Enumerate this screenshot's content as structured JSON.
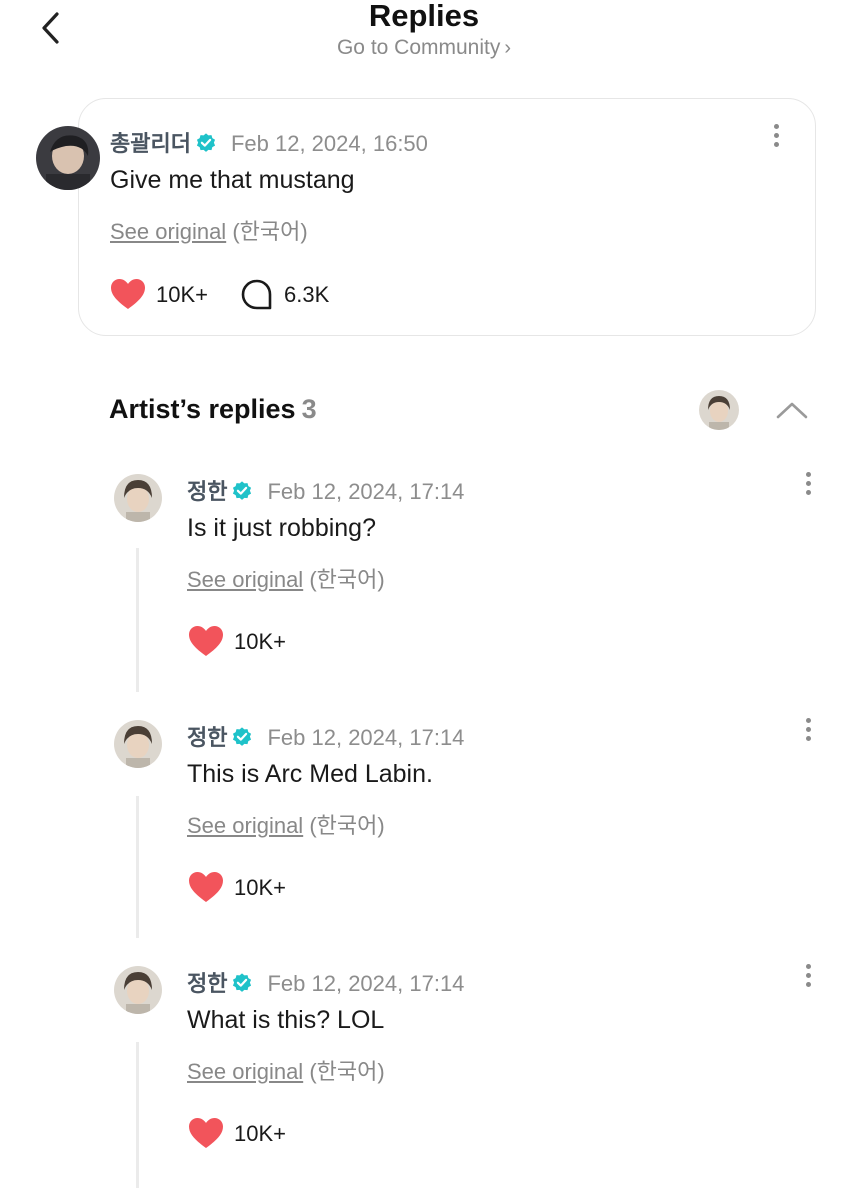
{
  "header": {
    "title": "Replies",
    "community_link": "Go to Community"
  },
  "post": {
    "author": "총괄리더",
    "timestamp": "Feb 12, 2024, 16:50",
    "text": "Give me that mustang",
    "see_original": "See original",
    "language": "(한국어)",
    "likes": "10K+",
    "comments": "6.3K"
  },
  "artist_replies": {
    "title": "Artist’s replies",
    "count": "3",
    "items": [
      {
        "author": "정한",
        "timestamp": "Feb 12, 2024, 17:14",
        "text": "Is it just robbing?",
        "see_original": "See original",
        "language": "(한국어)",
        "likes": "10K+"
      },
      {
        "author": "정한",
        "timestamp": "Feb 12, 2024, 17:14",
        "text": "This is Arc Med Labin.",
        "see_original": "See original",
        "language": "(한국어)",
        "likes": "10K+"
      },
      {
        "author": "정한",
        "timestamp": "Feb 12, 2024, 17:14",
        "text": "What is this? LOL",
        "see_original": "See original",
        "language": "(한국어)",
        "likes": "10K+"
      }
    ]
  },
  "icons": {
    "back": "back-chevron-icon",
    "verified": "verified-badge-icon",
    "more": "more-vertical-icon",
    "heart": "heart-icon",
    "comment": "comment-bubble-icon",
    "collapse": "chevron-up-icon"
  },
  "colors": {
    "heart": "#f2545b",
    "verified": "#1fc2c9",
    "muted_text": "#8a8a8a",
    "author_text": "#4a5561"
  }
}
